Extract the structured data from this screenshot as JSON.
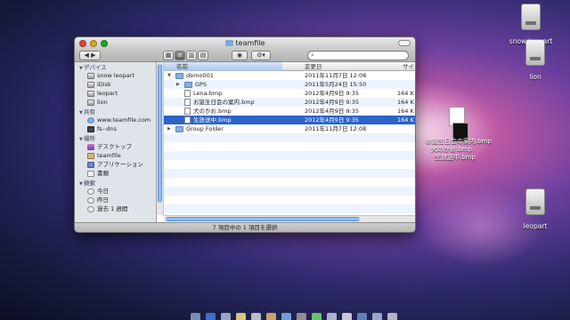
{
  "window": {
    "title": "teamfile",
    "search": {
      "value": "",
      "placeholder": ""
    },
    "status_text": "7 項目中の 1 項目を選択"
  },
  "sidebar": {
    "sections": [
      {
        "label": "デバイス",
        "items": [
          {
            "label": "snow leopart",
            "icon": "disk"
          },
          {
            "label": "iDisk",
            "icon": "disk"
          },
          {
            "label": "leopart",
            "icon": "disk"
          },
          {
            "label": "lion",
            "icon": "disk"
          }
        ]
      },
      {
        "label": "共有",
        "items": [
          {
            "label": "www.teamfile.com",
            "icon": "globe"
          },
          {
            "label": "fs--dns",
            "icon": "monitor"
          }
        ]
      },
      {
        "label": "場所",
        "items": [
          {
            "label": "デスクトップ",
            "icon": "desktop"
          },
          {
            "label": "teamfile",
            "icon": "home"
          },
          {
            "label": "アプリケーション",
            "icon": "applications"
          },
          {
            "label": "書類",
            "icon": "documents"
          }
        ]
      },
      {
        "label": "検索",
        "items": [
          {
            "label": "今日",
            "icon": "clock"
          },
          {
            "label": "昨日",
            "icon": "clock"
          },
          {
            "label": "過去 1 週間",
            "icon": "clock"
          }
        ]
      }
    ]
  },
  "columns": {
    "name": "名前",
    "date": "変更日",
    "size": "サイ"
  },
  "rows": [
    {
      "name": "demo001",
      "date": "2011年11月7日 12:08",
      "size": "",
      "kind": "folder",
      "level": 0,
      "disclosure": "▼"
    },
    {
      "name": "GPS",
      "date": "2011年5月24日 15:50",
      "size": "",
      "kind": "folder",
      "level": 1,
      "disclosure": "▶"
    },
    {
      "name": "Lena.bmp",
      "date": "2012年4月9日 9:35",
      "size": "164 K",
      "kind": "file",
      "level": 1,
      "disclosure": ""
    },
    {
      "name": "お誕生日会の案内.bmp",
      "date": "2012年4月9日 9:35",
      "size": "164 K",
      "kind": "file",
      "level": 1,
      "disclosure": ""
    },
    {
      "name": "犬のかお.bmp",
      "date": "2012年4月9日 9:35",
      "size": "164 K",
      "kind": "file",
      "level": 1,
      "disclosure": ""
    },
    {
      "name": "生放送中.bmp",
      "date": "2012年4月9日 9:35",
      "size": "164 K",
      "kind": "file",
      "level": 1,
      "disclosure": "",
      "selected": true
    },
    {
      "name": "Group Folder",
      "date": "2011年11月7日 12:08",
      "size": "",
      "kind": "folder",
      "level": 0,
      "disclosure": "▶"
    }
  ],
  "desktop_icons": [
    {
      "label": "snow leopart"
    },
    {
      "label": "lion"
    },
    {
      "label": "leopart"
    }
  ],
  "drag_labels": [
    "お誕生日会の案内.bmp",
    "犬のかお.bmp",
    "生放送中.bmp"
  ],
  "colors": {
    "selection": "#2c63c9",
    "close": "#e0443e",
    "minimize": "#dea123",
    "zoom": "#1aab29"
  }
}
